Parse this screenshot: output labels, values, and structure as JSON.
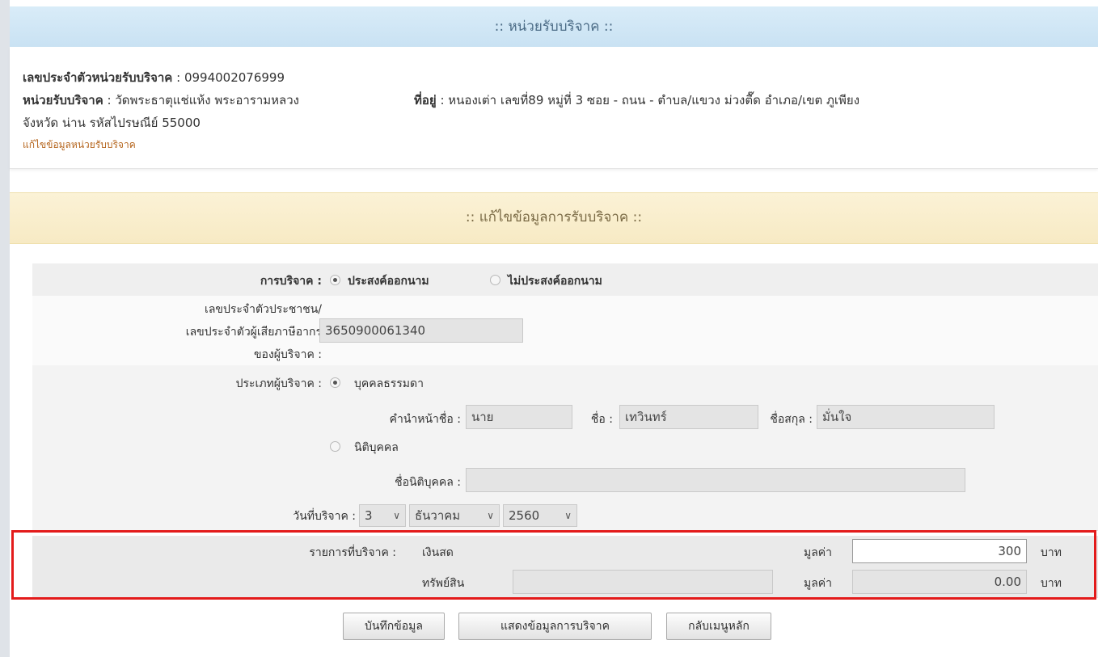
{
  "agency_header": {
    "title": ":: หน่วยรับบริจาค ::"
  },
  "agency": {
    "id_label": "เลขประจำตัวหน่วยรับบริจาค",
    "id_value": ": 0994002076999",
    "name_label": "หน่วยรับบริจาค",
    "name_value": ": วัดพระธาตุแช่แห้ง พระอารามหลวง",
    "address_label": "ที่อยู่",
    "address_value": ": หนองเต่า เลขที่89 หมู่ที่ 3 ซอย - ถนน - ตำบล/แขวง ม่วงตื๊ด อำเภอ/เขต ภูเพียง",
    "address_line2": "จังหวัด น่าน รหัสไปรษณีย์ 55000",
    "edit_link": "แก้ไขข้อมูลหน่วยรับบริจาค"
  },
  "donation_header": {
    "title": ":: แก้ไขข้อมูลการรับบริจาค ::"
  },
  "form": {
    "donation_type_label": "การบริจาค :",
    "option_named": "ประสงค์ออกนาม",
    "option_anonymous": "ไม่ประสงค์ออกนาม",
    "taxid_label_1": "เลขประจำตัวประชาชน/",
    "taxid_label_2": "เลขประจำตัวผู้เสียภาษีอากร",
    "taxid_label_3": "ของผู้บริจาค :",
    "taxid_value": "3650900061340",
    "donor_type_label": "ประเภทผู้บริจาค :",
    "option_person": "บุคคลธรรมดา",
    "title_label": "คำนำหน้าชื่อ :",
    "title_value": "นาย",
    "firstname_label": "ชื่อ :",
    "firstname_value": "เทวินทร์",
    "lastname_label": "ชื่อสกุล :",
    "lastname_value": "มั่นใจ",
    "option_juristic": "นิติบุคคล",
    "juristic_name_label": "ชื่อนิติบุคคล :",
    "juristic_name_value": "",
    "date_label": "วันที่บริจาค :",
    "day": "3",
    "month": "ธันวาคม",
    "year": "2560",
    "items_label": "รายการที่บริจาค :",
    "cash_label": "เงินสด",
    "cash_value_label": "มูลค่า",
    "cash_value": "300",
    "cash_unit": "บาท",
    "asset_label": "ทรัพย์สิน",
    "asset_desc": "",
    "asset_value_label": "มูลค่า",
    "asset_value": "0.00",
    "asset_unit": "บาท"
  },
  "buttons": {
    "save": "บันทึกข้อมูล",
    "show": "แสดงข้อมูลการบริจาค",
    "back": "กลับเมนูหลัก"
  },
  "colors": {
    "highlight": "#e31b1b",
    "header_blue": "#d0e6f5",
    "header_yellow": "#f9eecd"
  }
}
